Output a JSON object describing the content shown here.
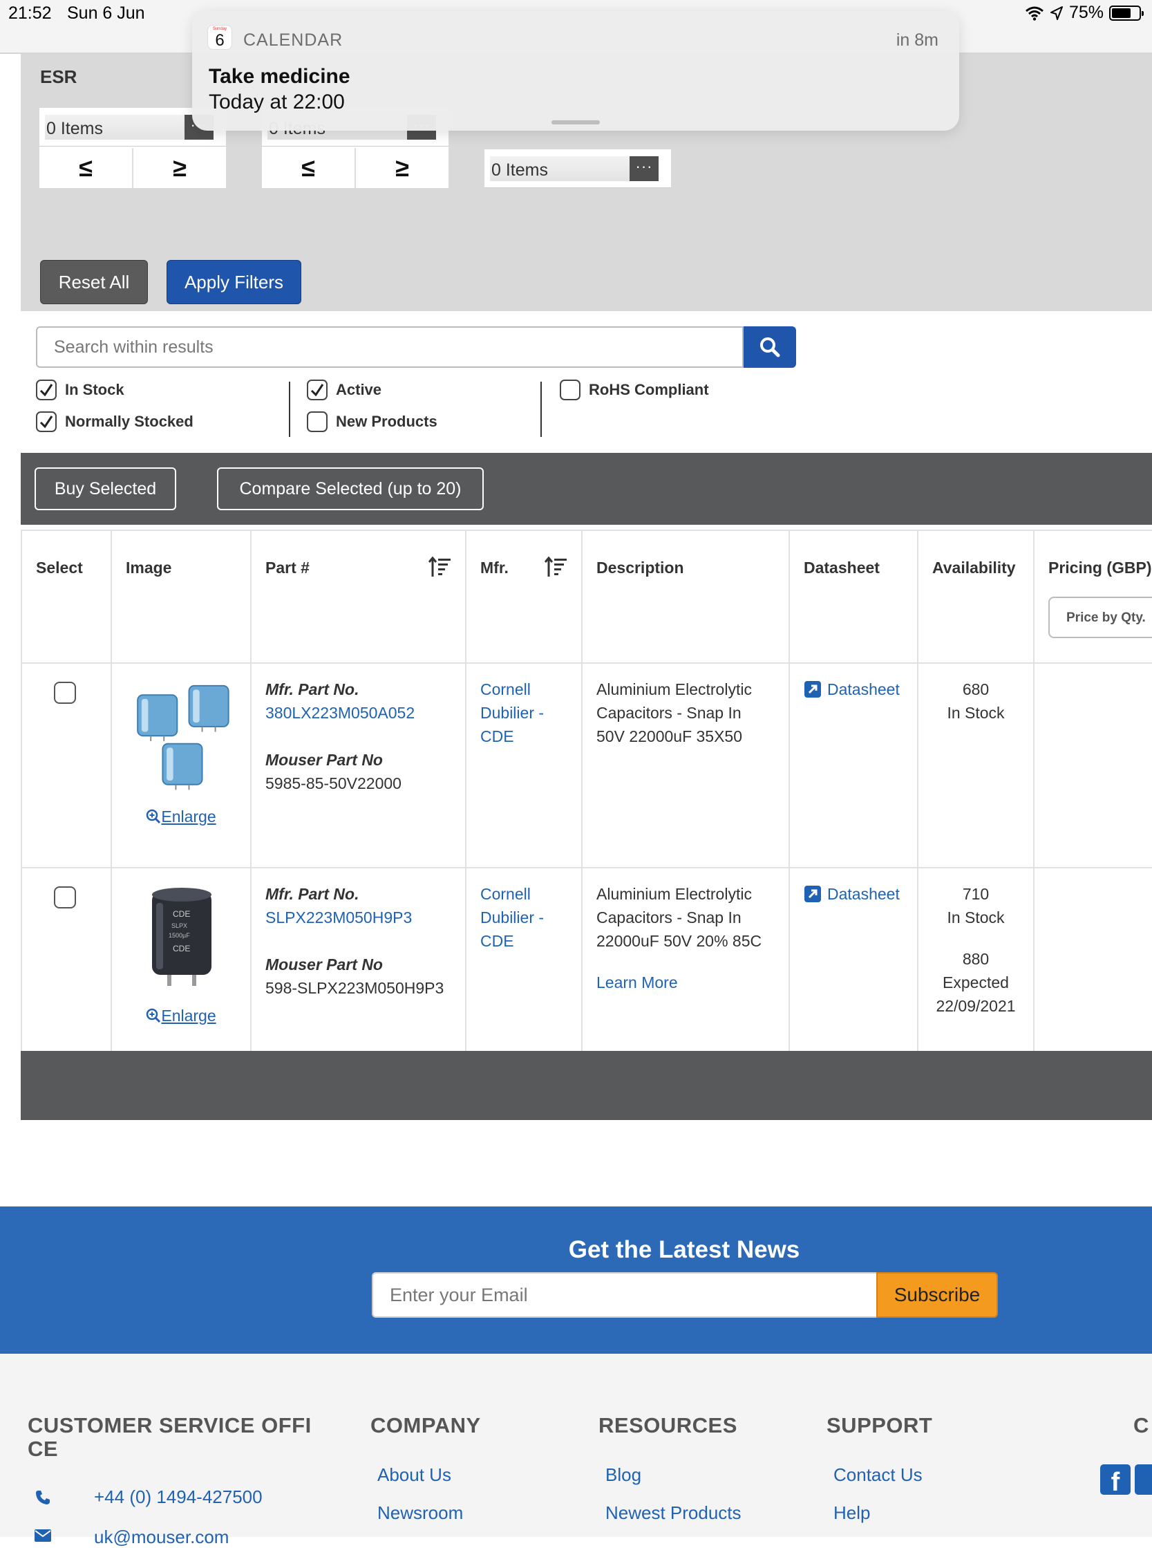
{
  "status_bar": {
    "time": "21:52",
    "date": "Sun 6 Jun",
    "battery": "75%"
  },
  "notification": {
    "app_name": "CALENDAR",
    "icon_day": "6",
    "icon_weekday": "Sunday",
    "relative_time": "in 8m",
    "title": "Take medicine",
    "body": "Today at 22:00"
  },
  "filters": {
    "section_label": "ESR",
    "boxes": [
      {
        "select_text": "0 Items",
        "dots": "···",
        "le": "≤",
        "ge": "≥"
      },
      {
        "select_text": "0 Items",
        "dots": "···",
        "le": "≤",
        "ge": "≥"
      },
      {
        "select_text": "0 Items",
        "dots": "···"
      }
    ],
    "reset_label": "Reset All",
    "apply_label": "Apply Filters"
  },
  "search": {
    "placeholder": "Search within results"
  },
  "checkboxes": {
    "in_stock": {
      "label": "In Stock",
      "checked": true
    },
    "normally_stocked": {
      "label": "Normally Stocked",
      "checked": true
    },
    "active": {
      "label": "Active",
      "checked": true
    },
    "new_products": {
      "label": "New Products",
      "checked": false
    },
    "rohs": {
      "label": "RoHS Compliant",
      "checked": false
    }
  },
  "actions": {
    "buy_label": "Buy Selected",
    "compare_label": "Compare Selected (up to 20)"
  },
  "table": {
    "headers": {
      "select": "Select",
      "image": "Image",
      "part": "Part #",
      "mfr": "Mfr.",
      "description": "Description",
      "datasheet": "Datasheet",
      "availability": "Availability",
      "pricing": "Pricing (GBP)"
    },
    "price_by_qty": "Price by Qty.",
    "rows": [
      {
        "mfr_part_label": "Mfr. Part No.",
        "mfr_part": "380LX223M050A052",
        "mouser_part_label": "Mouser Part No",
        "mouser_part": "5985-85-50V22000",
        "mfr_line1": "Cornell",
        "mfr_line2": "Dubilier -",
        "mfr_line3": "CDE",
        "desc_line1": "Aluminium Electrolytic",
        "desc_line2": "Capacitors - Snap In",
        "desc_line3": "50V 22000uF 35X50",
        "datasheet": "Datasheet",
        "avail_qty": "680",
        "avail_status": "In Stock",
        "enlarge": "Enlarge"
      },
      {
        "mfr_part_label": "Mfr. Part No.",
        "mfr_part": "SLPX223M050H9P3",
        "mouser_part_label": "Mouser Part No",
        "mouser_part": "598-SLPX223M050H9P3",
        "mfr_line1": "Cornell",
        "mfr_line2": "Dubilier -",
        "mfr_line3": "CDE",
        "desc_line1": "Aluminium Electrolytic",
        "desc_line2": "Capacitors - Snap In",
        "desc_line3": "22000uF 50V 20% 85C",
        "learn_more": "Learn More",
        "datasheet": "Datasheet",
        "avail_qty": "710",
        "avail_status": "In Stock",
        "expected_qty": "880",
        "expected_label": "Expected",
        "expected_date": "22/09/2021",
        "enlarge": "Enlarge"
      }
    ]
  },
  "newsletter": {
    "title": "Get the Latest News",
    "placeholder": "Enter your Email",
    "button": "Subscribe"
  },
  "footer": {
    "cs_title_line1": "CUSTOMER SERVICE OFFI",
    "cs_title_line2": "CE",
    "phone": "+44 (0) 1494-427500",
    "email": "uk@mouser.com",
    "company_title": "COMPANY",
    "company_links": [
      "About Us",
      "Newsroom"
    ],
    "resources_title": "RESOURCES",
    "resources_links": [
      "Blog",
      "Newest Products"
    ],
    "support_title": "SUPPORT",
    "support_links": [
      "Contact Us",
      "Help"
    ],
    "cut_title": "C"
  }
}
